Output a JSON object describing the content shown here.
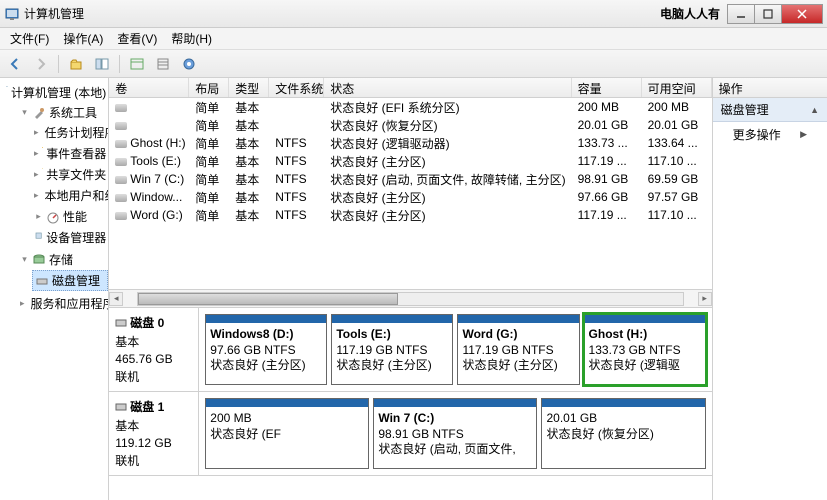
{
  "window": {
    "title": "计算机管理",
    "brand": "电脑人人有"
  },
  "menu": {
    "file": "文件(F)",
    "action": "操作(A)",
    "view": "查看(V)",
    "help": "帮助(H)"
  },
  "tree": {
    "root": "计算机管理 (本地)",
    "system_tools": "系统工具",
    "task_scheduler": "任务计划程序",
    "event_viewer": "事件查看器",
    "shared_folders": "共享文件夹",
    "local_users": "本地用户和组",
    "performance": "性能",
    "device_manager": "设备管理器",
    "storage": "存储",
    "disk_management": "磁盘管理",
    "services_apps": "服务和应用程序"
  },
  "columns": {
    "volume": "卷",
    "layout": "布局",
    "type": "类型",
    "fs": "文件系统",
    "status": "状态",
    "capacity": "容量",
    "free": "可用空间"
  },
  "volumes": [
    {
      "name": "",
      "layout": "简单",
      "type": "基本",
      "fs": "",
      "status": "状态良好 (EFI 系统分区)",
      "cap": "200 MB",
      "free": "200 MB"
    },
    {
      "name": "",
      "layout": "简单",
      "type": "基本",
      "fs": "",
      "status": "状态良好 (恢复分区)",
      "cap": "20.01 GB",
      "free": "20.01 GB"
    },
    {
      "name": "Ghost (H:)",
      "layout": "简单",
      "type": "基本",
      "fs": "NTFS",
      "status": "状态良好 (逻辑驱动器)",
      "cap": "133.73 ...",
      "free": "133.64 ..."
    },
    {
      "name": "Tools (E:)",
      "layout": "简单",
      "type": "基本",
      "fs": "NTFS",
      "status": "状态良好 (主分区)",
      "cap": "117.19 ...",
      "free": "117.10 ..."
    },
    {
      "name": "Win 7 (C:)",
      "layout": "简单",
      "type": "基本",
      "fs": "NTFS",
      "status": "状态良好 (启动, 页面文件, 故障转储, 主分区)",
      "cap": "98.91 GB",
      "free": "69.59 GB"
    },
    {
      "name": "Window...",
      "layout": "简单",
      "type": "基本",
      "fs": "NTFS",
      "status": "状态良好 (主分区)",
      "cap": "97.66 GB",
      "free": "97.57 GB"
    },
    {
      "name": "Word (G:)",
      "layout": "简单",
      "type": "基本",
      "fs": "NTFS",
      "status": "状态良好 (主分区)",
      "cap": "117.19 ...",
      "free": "117.10 ..."
    }
  ],
  "disks": [
    {
      "label": "磁盘 0",
      "basic": "基本",
      "size": "465.76 GB",
      "online": "联机",
      "partitions": [
        {
          "name": "Windows8  (D:)",
          "size": "97.66 GB NTFS",
          "status": "状态良好 (主分区)",
          "highlight": false
        },
        {
          "name": "Tools  (E:)",
          "size": "117.19 GB NTFS",
          "status": "状态良好 (主分区)",
          "highlight": false
        },
        {
          "name": "Word  (G:)",
          "size": "117.19 GB NTFS",
          "status": "状态良好 (主分区)",
          "highlight": false
        },
        {
          "name": "Ghost  (H:)",
          "size": "133.73 GB NTFS",
          "status": "状态良好 (逻辑驱",
          "highlight": true
        }
      ]
    },
    {
      "label": "磁盘 1",
      "basic": "基本",
      "size": "119.12 GB",
      "online": "联机",
      "partitions": [
        {
          "name": "",
          "size": "200 MB",
          "status": "状态良好 (EF",
          "highlight": false
        },
        {
          "name": "Win 7  (C:)",
          "size": "98.91 GB NTFS",
          "status": "状态良好 (启动, 页面文件,",
          "highlight": false
        },
        {
          "name": "",
          "size": "20.01 GB",
          "status": "状态良好 (恢复分区)",
          "highlight": false
        }
      ]
    }
  ],
  "actions": {
    "header": "操作",
    "section": "磁盘管理",
    "more": "更多操作"
  }
}
